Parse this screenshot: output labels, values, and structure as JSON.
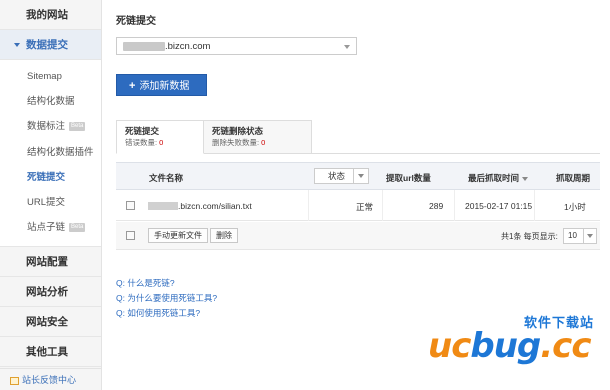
{
  "sidebar": {
    "sections": [
      {
        "label": "我的网站"
      },
      {
        "label": "数据提交"
      },
      {
        "label": "网站配置"
      },
      {
        "label": "网站分析"
      },
      {
        "label": "网站安全"
      },
      {
        "label": "其他工具"
      }
    ],
    "subitems": [
      {
        "label": "Sitemap"
      },
      {
        "label": "结构化数据"
      },
      {
        "label": "数据标注",
        "badge": "Beta"
      },
      {
        "label": "结构化数据插件"
      },
      {
        "label": "死链提交"
      },
      {
        "label": "URL提交"
      },
      {
        "label": "站点子链",
        "badge": "Beta"
      }
    ],
    "feedback": "站长反馈中心"
  },
  "main": {
    "title": "死链提交",
    "site_select": {
      "value": ".bizcn.com"
    },
    "add_button": "添加新数据",
    "tabs": [
      {
        "title": "死链提交",
        "sub_label": "错误数量:",
        "count": "0"
      },
      {
        "title": "死链删除状态",
        "sub_label": "删除失败数量:",
        "count": "0"
      }
    ],
    "table": {
      "headers": {
        "file_name": "文件名称",
        "status": "状态",
        "url_count": "提取url数量",
        "last_crawl": "最后抓取时间",
        "crawl_cycle": "抓取周期"
      },
      "rows": [
        {
          "url": ".bizcn.com/silian.txt",
          "status": "正常",
          "url_count": "289",
          "last_crawl": "2015-02-17 01:15",
          "cycle": "1小时"
        }
      ],
      "actions": {
        "update": "手动更新文件",
        "delete": "删除",
        "pager_text": "共1条 每页显示:",
        "page_size": "10"
      }
    },
    "faq": [
      "Q: 什么是死链?",
      "Q: 为什么要使用死链工具?",
      "Q: 如何使用死链工具?"
    ]
  },
  "watermark": {
    "top": "软件下载站",
    "part1": "uc",
    "part2": "bug",
    "part3": ".cc"
  },
  "colors": {
    "accent": "#2d6bbf",
    "error": "#cc0000",
    "watermark_orange": "#f08a14",
    "watermark_blue": "#1d77d6"
  }
}
